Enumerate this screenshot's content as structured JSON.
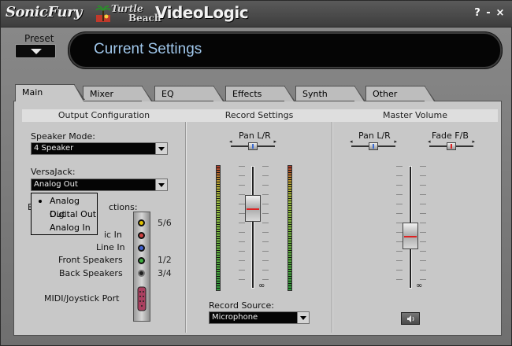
{
  "titlebar": {
    "brand_sonicfury": "SonicFury",
    "brand_turtle": "Turtle",
    "brand_beach": "Beach",
    "brand_videologic": "VideoLogic",
    "help": "?",
    "minimize": "-",
    "close": "×"
  },
  "preset": {
    "label": "Preset"
  },
  "banner": {
    "text": "Current Settings"
  },
  "tabs": [
    {
      "label": "Main"
    },
    {
      "label": "Mixer"
    },
    {
      "label": "EQ"
    },
    {
      "label": "Effects"
    },
    {
      "label": "Synth"
    },
    {
      "label": "Other"
    }
  ],
  "sections": {
    "output": "Output Configuration",
    "record": "Record Settings",
    "master": "Master Volume"
  },
  "output": {
    "speaker_mode_label": "Speaker Mode:",
    "speaker_mode_value": "4 Speaker",
    "versajack_label": "VersaJack:",
    "versajack_value": "Analog Out",
    "connections_label_start": "E",
    "connections_label_end": "ctions:",
    "popup_options": [
      "Analog Out",
      "Digital Out",
      "Analog In"
    ],
    "popup_selected": "Analog Out",
    "connectors": [
      {
        "label": "",
        "num": "5/6",
        "color": "#e0c000"
      },
      {
        "label": "ic In",
        "num": "",
        "color": "#d04040"
      },
      {
        "label": "Line In",
        "num": "",
        "color": "#4060d0"
      },
      {
        "label": "Front Speakers",
        "num": "1/2",
        "color": "#40b040"
      },
      {
        "label": "Back Speakers",
        "num": "3/4",
        "color": "#202020"
      }
    ],
    "midi_label": "MIDI/Joystick Port"
  },
  "record": {
    "pan_label": "Pan L/R",
    "infinity": "∞",
    "source_label": "Record Source:",
    "source_value": "Microphone"
  },
  "master": {
    "pan_label": "Pan L/R",
    "fade_label": "Fade F/B",
    "infinity": "∞"
  },
  "colors": {
    "banner_text": "#9fc6ea",
    "fader_line": "#dd2222"
  }
}
